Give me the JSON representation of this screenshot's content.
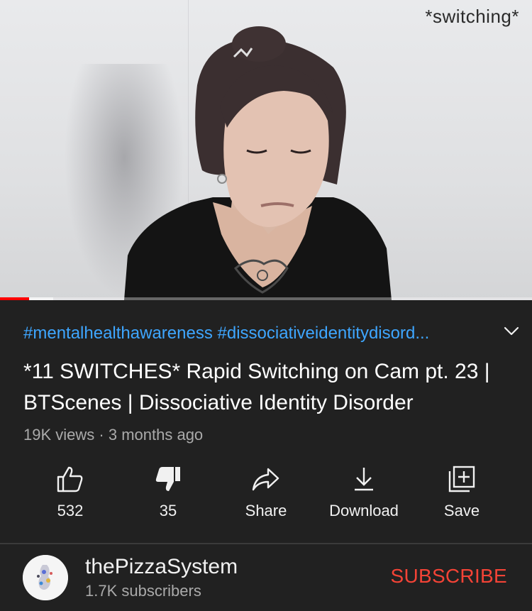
{
  "player": {
    "overlay_text": "*switching*",
    "progress_played_fraction": 0.055,
    "progress_buffered_fraction": 0.1
  },
  "video": {
    "tags": "#mentalhealthawareness #dissociativeidentitydisord...",
    "title": "*11 SWITCHES* Rapid Switching on Cam pt. 23 | BTScenes | Dissociative Identity Disorder",
    "views": "19K views",
    "separator": "·",
    "age": "3 months ago"
  },
  "actions": {
    "like": {
      "label": "532",
      "icon": "thumbs-up-icon"
    },
    "dislike": {
      "label": "35",
      "icon": "thumbs-down-filled-icon"
    },
    "share": {
      "label": "Share",
      "icon": "share-arrow-icon"
    },
    "download": {
      "label": "Download",
      "icon": "download-icon"
    },
    "save": {
      "label": "Save",
      "icon": "playlist-add-icon"
    }
  },
  "channel": {
    "name": "thePizzaSystem",
    "subscribers": "1.7K subscribers",
    "subscribe_label": "SUBSCRIBE"
  },
  "colors": {
    "background": "#212121",
    "hashtag": "#3ea6ff",
    "subscribe": "#f44336",
    "progress": "#ff0000",
    "secondary_text": "#aaaaaa"
  }
}
